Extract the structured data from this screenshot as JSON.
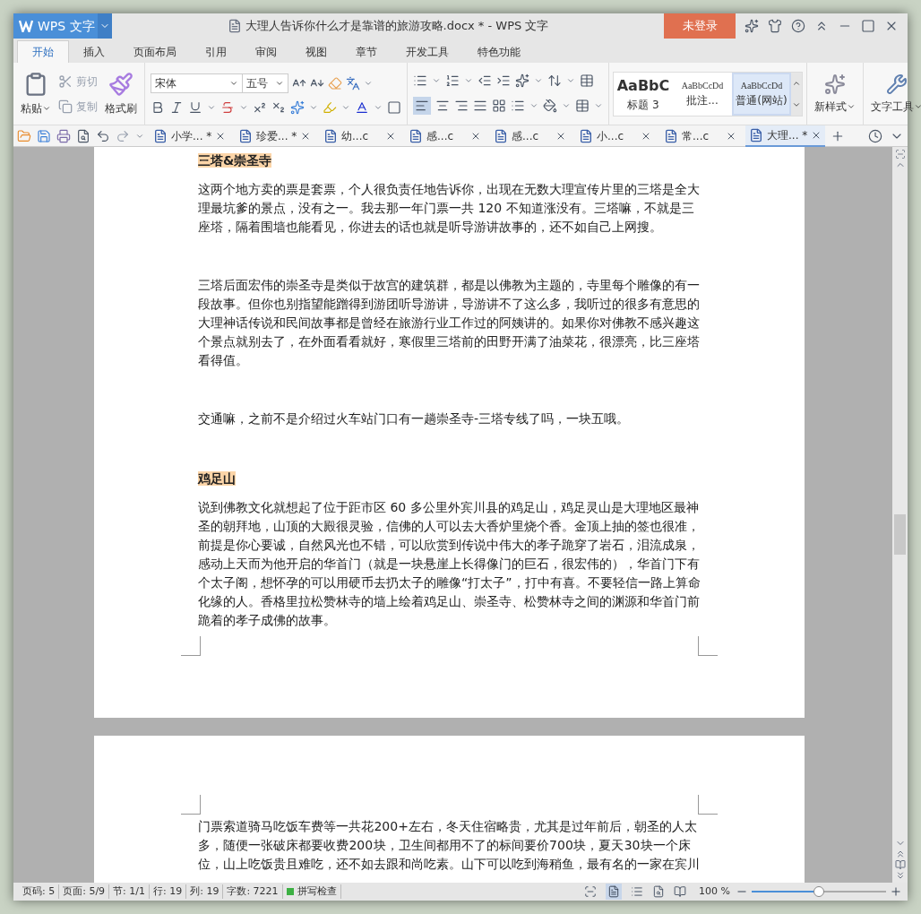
{
  "app": {
    "logo": "WPS 文字",
    "title": "大理人告诉你什么才是靠谱的旅游攻略.docx * - WPS 文字",
    "login": "未登录"
  },
  "ribbon_tabs": [
    {
      "label": "开始",
      "selected": true
    },
    {
      "label": "插入",
      "selected": false
    },
    {
      "label": "页面布局",
      "selected": false
    },
    {
      "label": "引用",
      "selected": false
    },
    {
      "label": "审阅",
      "selected": false
    },
    {
      "label": "视图",
      "selected": false
    },
    {
      "label": "章节",
      "selected": false
    },
    {
      "label": "开发工具",
      "selected": false
    },
    {
      "label": "特色功能",
      "selected": false
    }
  ],
  "clipboard": {
    "paste": "粘贴",
    "cut": "剪切",
    "copy": "复制",
    "format_painter": "格式刷"
  },
  "font": {
    "family": "宋体",
    "size": "五号"
  },
  "styles": [
    {
      "preview": "AaBbC",
      "label": "标题 3",
      "selected": false
    },
    {
      "preview": "AaBbCcDd",
      "label": "批注...",
      "selected": false
    },
    {
      "preview": "AaBbCcDd",
      "label": "普通(网站)",
      "selected": true
    }
  ],
  "new_style": "新样式",
  "text_tools": "文字工具",
  "doc_tabs": [
    {
      "label": "小学... *",
      "selected": false
    },
    {
      "label": "珍爱... *",
      "selected": false
    },
    {
      "label": "幼...c",
      "selected": false
    },
    {
      "label": "感...c",
      "selected": false
    },
    {
      "label": "感...c",
      "selected": false
    },
    {
      "label": "小...c",
      "selected": false
    },
    {
      "label": "常...c",
      "selected": false
    },
    {
      "label": "大理... *",
      "selected": true
    }
  ],
  "pages": [
    {
      "blocks": [
        {
          "kind": "heading",
          "text": "三塔&崇圣寺"
        },
        {
          "kind": "paragraph",
          "text": "这两个地方卖的票是套票，个人很负责任地告诉你，出现在无数大理宣传片里的三塔是全大理最坑爹的景点，没有之一。我去那一年门票一共 120 不知道涨没有。三塔嘛，不就是三座塔，隔着围墙也能看见，你进去的话也就是听导游讲故事的，还不如自己上网搜。"
        },
        {
          "kind": "blank"
        },
        {
          "kind": "paragraph",
          "text": "三塔后面宏伟的崇圣寺是类似于故宫的建筑群，都是以佛教为主题的，寺里每个雕像的有一段故事。但你也别指望能蹭得到游团听导游讲，导游讲不了这么多，我听过的很多有意思的大理神话传说和民间故事都是曾经在旅游行业工作过的阿姨讲的。如果你对佛教不感兴趣这个景点就别去了，在外面看看就好，寒假里三塔前的田野开满了油菜花，很漂亮，比三座塔看得值。"
        },
        {
          "kind": "blank"
        },
        {
          "kind": "paragraph",
          "text": "交通嘛，之前不是介绍过火车站门口有一趟崇圣寺-三塔专线了吗，一块五哦。"
        },
        {
          "kind": "blank"
        },
        {
          "kind": "heading",
          "text": "鸡足山"
        },
        {
          "kind": "paragraph",
          "text": "说到佛教文化就想起了位于距市区 60 多公里外宾川县的鸡足山，鸡足灵山是大理地区最神圣的朝拜地，山顶的大殿很灵验，信佛的人可以去大香炉里烧个香。金顶上抽的签也很准，前提是你心要诚，自然风光也不错，可以欣赏到传说中伟大的孝子跪穿了岩石，泪流成泉，感动上天而为他开启的华首门（就是一块悬崖上长得像门的巨石，很宏伟的），华首门下有个太子阁，想怀孕的可以用硬币去扔太子的雕像“打太子”，打中有喜。不要轻信一路上算命化缘的人。香格里拉松赞林寺的墙上绘着鸡足山、崇圣寺、松赞林寺之间的渊源和华首门前跪着的孝子成佛的故事。"
        }
      ]
    },
    {
      "blocks": [
        {
          "kind": "paragraph",
          "text": "门票索道骑马吃饭车费等一共花 200+左右，冬天住宿略贵，尤其是过年前后，朝圣的人太多，随便一张破床都要收费 200 块，卫生间都用不了的标间要价 700 块，夏天 30 块一个床位，山上吃饭贵且难吃，还不如去跟和尚吃素。山下可以吃到海稍鱼，最有名的一家在宾川"
        }
      ]
    }
  ],
  "status_bar": {
    "items": [
      "页码: 5",
      "页面: 5/9",
      "节: 1/1",
      "行: 19",
      "列: 19",
      "字数: 7221"
    ],
    "spell_check": "拼写检查",
    "zoom": "100 %",
    "zoom_slider": {
      "level": 0.5
    }
  }
}
